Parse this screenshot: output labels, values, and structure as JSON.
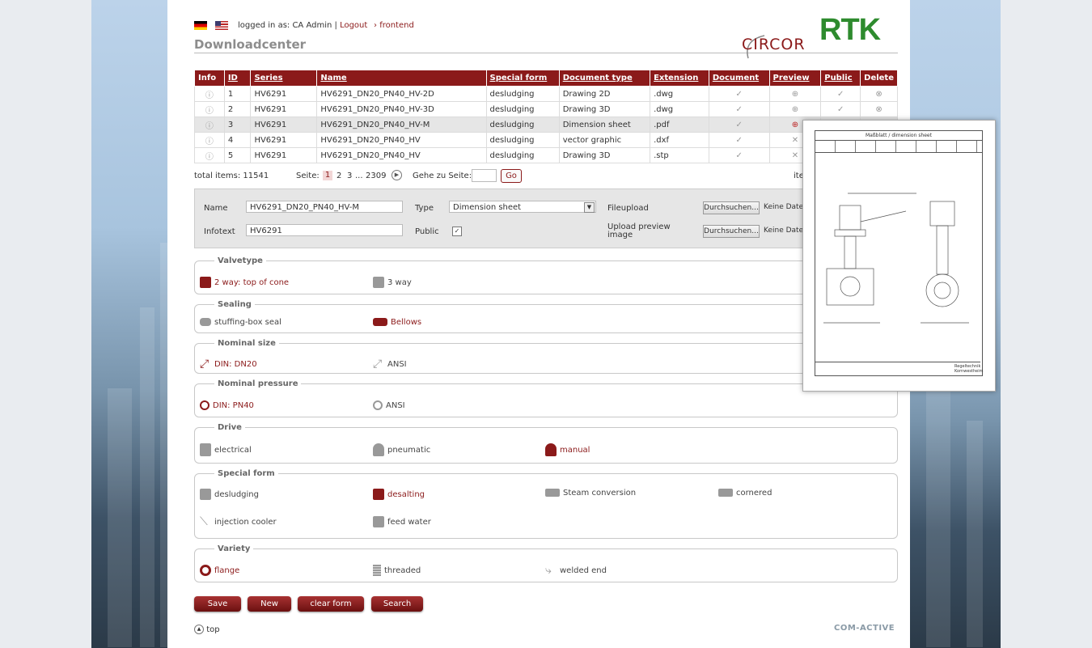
{
  "header": {
    "logged_in_as": "logged in as: CA Admin |",
    "logout": "Logout",
    "frontend": "frontend",
    "title": "Downloadcenter",
    "logo_left": "CIRCOR",
    "logo_right": "RTK"
  },
  "table": {
    "columns": [
      "Info",
      "ID",
      "Series",
      "Name",
      "Special form",
      "Document type",
      "Extension",
      "Document",
      "Preview",
      "Public",
      "Delete"
    ],
    "rows": [
      {
        "id": "1",
        "series": "HV6291",
        "name": "HV6291_DN20_PN40_HV-2D",
        "special": "desludging",
        "doctype": "Drawing 2D",
        "ext": ".dwg",
        "document": "✓",
        "preview": "⊕",
        "public": "✓",
        "delete": "⊗"
      },
      {
        "id": "2",
        "series": "HV6291",
        "name": "HV6291_DN20_PN40_HV-3D",
        "special": "desludging",
        "doctype": "Drawing 3D",
        "ext": ".dwg",
        "document": "✓",
        "preview": "⊕",
        "public": "✓",
        "delete": "⊗"
      },
      {
        "id": "3",
        "series": "HV6291",
        "name": "HV6291_DN20_PN40_HV-M",
        "special": "desludging",
        "doctype": "Dimension sheet",
        "ext": ".pdf",
        "document": "✓",
        "preview": "⊕",
        "public": "",
        "delete": ""
      },
      {
        "id": "4",
        "series": "HV6291",
        "name": "HV6291_DN20_PN40_HV",
        "special": "desludging",
        "doctype": "vector graphic",
        "ext": ".dxf",
        "document": "✓",
        "preview": "✕",
        "public": "",
        "delete": ""
      },
      {
        "id": "5",
        "series": "HV6291",
        "name": "HV6291_DN20_PN40_HV",
        "special": "desludging",
        "doctype": "Drawing 3D",
        "ext": ".stp",
        "document": "✓",
        "preview": "✕",
        "public": "",
        "delete": ""
      }
    ]
  },
  "pager": {
    "total": "total items: 11541",
    "seite": "Seite:",
    "p1": "1",
    "p2": "2",
    "p3": "3",
    "dots": "...",
    "last": "2309",
    "goto": "Gehe zu Seite:",
    "go": "Go",
    "items_cut": "ite"
  },
  "form": {
    "name_label": "Name",
    "name_value": "HV6291_DN20_PN40_HV-M",
    "infotext_label": "Infotext",
    "infotext_value": "HV6291",
    "type_label": "Type",
    "type_value": "Dimension sheet",
    "public_label": "Public",
    "fileupload_label": "Fileupload",
    "upload_preview_label1": "Upload preview",
    "upload_preview_label2": "image",
    "browse": "Durchsuchen...",
    "no_file": "Keine Datei"
  },
  "groups": {
    "valvetype": {
      "legend": "Valvetype",
      "opts": [
        "2 way: top of cone",
        "3 way"
      ]
    },
    "sealing": {
      "legend": "Sealing",
      "opts": [
        "stuffing-box seal",
        "Bellows"
      ]
    },
    "nominal_size": {
      "legend": "Nominal size",
      "opts": [
        "DIN: DN20",
        "ANSI"
      ]
    },
    "nominal_pressure": {
      "legend": "Nominal pressure",
      "opts": [
        "DIN: PN40",
        "ANSI"
      ]
    },
    "drive": {
      "legend": "Drive",
      "opts": [
        "electrical",
        "pneumatic",
        "manual"
      ]
    },
    "special_form": {
      "legend": "Special form",
      "opts": [
        "desludging",
        "desalting",
        "Steam conversion",
        "cornered",
        "injection cooler",
        "feed water"
      ]
    },
    "variety": {
      "legend": "Variety",
      "opts": [
        "flange",
        "threaded",
        "welded end"
      ]
    }
  },
  "buttons": {
    "save": "Save",
    "new": "New",
    "clear": "clear form",
    "search": "Search"
  },
  "footer": {
    "top": "top",
    "brand": "COM-ACTIVE"
  },
  "preview": {
    "sheet_title": "Maßblatt / dimension sheet",
    "brand": "Regeltechnik Kornwestheim"
  },
  "colors": {
    "accent": "#8b1a1a",
    "logo_green": "#2e8b2e"
  }
}
